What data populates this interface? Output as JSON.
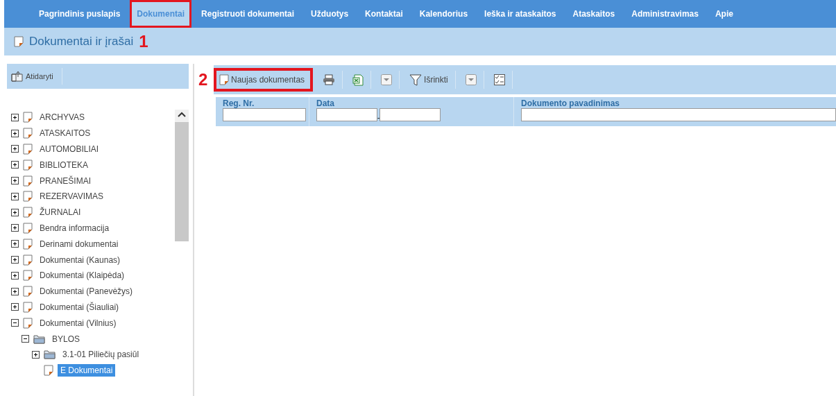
{
  "nav": [
    {
      "label": "Pagrindinis puslapis",
      "selected": false,
      "highlighted": false
    },
    {
      "label": "Dokumentai",
      "selected": true,
      "highlighted": true
    },
    {
      "label": "Registruoti dokumentai",
      "selected": false,
      "highlighted": false
    },
    {
      "label": "Užduotys",
      "selected": false,
      "highlighted": false
    },
    {
      "label": "Kontaktai",
      "selected": false,
      "highlighted": false
    },
    {
      "label": "Kalendorius",
      "selected": false,
      "highlighted": false
    },
    {
      "label": "Ieška ir ataskaitos",
      "selected": false,
      "highlighted": false
    },
    {
      "label": "Ataskaitos",
      "selected": false,
      "highlighted": false
    },
    {
      "label": "Administravimas",
      "selected": false,
      "highlighted": false
    },
    {
      "label": "Apie",
      "selected": false,
      "highlighted": false
    }
  ],
  "page_title": {
    "text": "Dokumentai ir įrašai",
    "marker": "1"
  },
  "left_toolbar": {
    "open_button": "Atidaryti"
  },
  "tree": [
    {
      "label": "ARCHYVAS",
      "kind": "doc",
      "expanded": false,
      "selected": false
    },
    {
      "label": "ATASKAITOS",
      "kind": "doc",
      "expanded": false,
      "selected": false
    },
    {
      "label": "AUTOMOBILIAI",
      "kind": "doc",
      "expanded": false,
      "selected": false
    },
    {
      "label": "BIBLIOTEKA",
      "kind": "doc",
      "expanded": false,
      "selected": false
    },
    {
      "label": "PRANEŠIMAI",
      "kind": "doc",
      "expanded": false,
      "selected": false
    },
    {
      "label": "REZERVAVIMAS",
      "kind": "doc",
      "expanded": false,
      "selected": false
    },
    {
      "label": "ŽURNALAI",
      "kind": "doc",
      "expanded": false,
      "selected": false
    },
    {
      "label": "Bendra informacija",
      "kind": "doc",
      "expanded": false,
      "selected": false
    },
    {
      "label": "Derinami dokumentai",
      "kind": "doc",
      "expanded": false,
      "selected": false
    },
    {
      "label": "Dokumentai (Kaunas)",
      "kind": "doc",
      "expanded": false,
      "selected": false
    },
    {
      "label": "Dokumentai (Klaipėda)",
      "kind": "doc",
      "expanded": false,
      "selected": false
    },
    {
      "label": "Dokumentai (Panevėžys)",
      "kind": "doc",
      "expanded": false,
      "selected": false
    },
    {
      "label": "Dokumentai (Šiauliai)",
      "kind": "doc",
      "expanded": false,
      "selected": false
    },
    {
      "label": "Dokumentai (Vilnius)",
      "kind": "doc",
      "expanded": true,
      "selected": false,
      "children": [
        {
          "label": "BYLOS",
          "kind": "folder",
          "expanded": true,
          "selected": false,
          "children": [
            {
              "label": "3.1-01 Piliečių pasiūl",
              "kind": "folder",
              "expanded": false,
              "selected": false
            },
            {
              "label": "E Dokumentai",
              "kind": "leaf",
              "selected": true
            }
          ]
        }
      ]
    }
  ],
  "toolbar": {
    "marker": "2",
    "new_button": {
      "label": "Naujas dokumentas",
      "highlighted": true
    },
    "filter_button": "Išrinkti"
  },
  "filters": [
    {
      "label": "Reg. Nr.",
      "kind": "single"
    },
    {
      "label": "Data",
      "kind": "range",
      "separator": "-"
    },
    {
      "label": "Dokumento pavadinimas",
      "kind": "wide"
    }
  ]
}
